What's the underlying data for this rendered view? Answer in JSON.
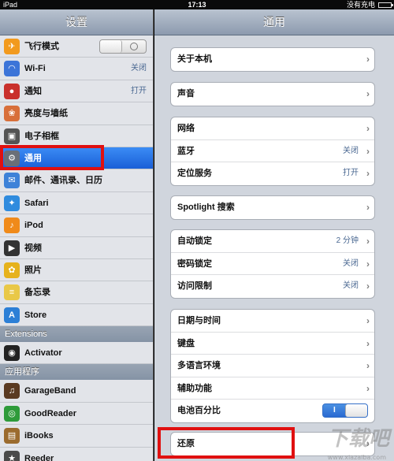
{
  "statusbar": {
    "device": "iPad",
    "time": "17:13",
    "charge": "没有充电"
  },
  "left": {
    "title": "设置",
    "items": [
      {
        "label": "飞行模式",
        "icon": "airplane-icon",
        "color": "#f29a1e",
        "glyph": "✈"
      },
      {
        "label": "Wi-Fi",
        "value": "关闭",
        "icon": "wifi-icon",
        "color": "#3c74d8",
        "glyph": "◠"
      },
      {
        "label": "通知",
        "value": "打开",
        "icon": "notification-icon",
        "color": "#c9302c",
        "glyph": "●"
      },
      {
        "label": "亮度与墙纸",
        "icon": "brightness-icon",
        "color": "#d86f3a",
        "glyph": "❀"
      },
      {
        "label": "电子相框",
        "icon": "picture-frame-icon",
        "color": "#545454",
        "glyph": "▣"
      },
      {
        "label": "通用",
        "icon": "gear-icon",
        "color": "#6a6f78",
        "glyph": "⚙"
      },
      {
        "label": "邮件、通讯录、日历",
        "icon": "mail-icon",
        "color": "#3e82d8",
        "glyph": "✉"
      },
      {
        "label": "Safari",
        "icon": "safari-icon",
        "color": "#2f8bde",
        "glyph": "✦"
      },
      {
        "label": "iPod",
        "icon": "ipod-icon",
        "color": "#f08a1a",
        "glyph": "♪"
      },
      {
        "label": "视频",
        "icon": "video-icon",
        "color": "#333333",
        "glyph": "▶"
      },
      {
        "label": "照片",
        "icon": "photos-icon",
        "color": "#e6b21c",
        "glyph": "✿"
      },
      {
        "label": "备忘录",
        "icon": "notes-icon",
        "color": "#e9c847",
        "glyph": "≡"
      },
      {
        "label": "Store",
        "icon": "store-icon",
        "color": "#2c7fd6",
        "glyph": "A"
      }
    ],
    "extensions_header": "Extensions",
    "extensions": [
      {
        "label": "Activator",
        "icon": "activator-icon",
        "color": "#222222",
        "glyph": "◉"
      }
    ],
    "apps_header": "应用程序",
    "apps": [
      {
        "label": "GarageBand",
        "icon": "guitar-icon",
        "color": "#5a3a22",
        "glyph": "♫"
      },
      {
        "label": "GoodReader",
        "icon": "eye-icon",
        "color": "#2e9b3a",
        "glyph": "◎"
      },
      {
        "label": "iBooks",
        "icon": "book-icon",
        "color": "#9b6b2e",
        "glyph": "▤"
      },
      {
        "label": "Reeder",
        "icon": "reeder-icon",
        "color": "#4a4a4a",
        "glyph": "★"
      }
    ]
  },
  "right": {
    "title": "通用",
    "groups": [
      [
        {
          "label": "关于本机"
        }
      ],
      [
        {
          "label": "声音"
        }
      ],
      [
        {
          "label": "网络"
        },
        {
          "label": "蓝牙",
          "value": "关闭"
        },
        {
          "label": "定位服务",
          "value": "打开"
        }
      ],
      [
        {
          "label": "Spotlight 搜索"
        }
      ],
      [
        {
          "label": "自动锁定",
          "value": "2 分钟"
        },
        {
          "label": "密码锁定",
          "value": "关闭"
        },
        {
          "label": "访问限制",
          "value": "关闭"
        }
      ],
      [
        {
          "label": "日期与时间"
        },
        {
          "label": "键盘"
        },
        {
          "label": "多语言环境"
        },
        {
          "label": "辅助功能"
        },
        {
          "label": "电池百分比",
          "toggle": "I"
        }
      ],
      [
        {
          "label": "还原"
        }
      ]
    ]
  },
  "watermark": {
    "brand": "下载吧",
    "url": "www.xiazaiba.com"
  },
  "colors": {
    "highlight": "#e01010",
    "selected": "#1f66dc"
  }
}
